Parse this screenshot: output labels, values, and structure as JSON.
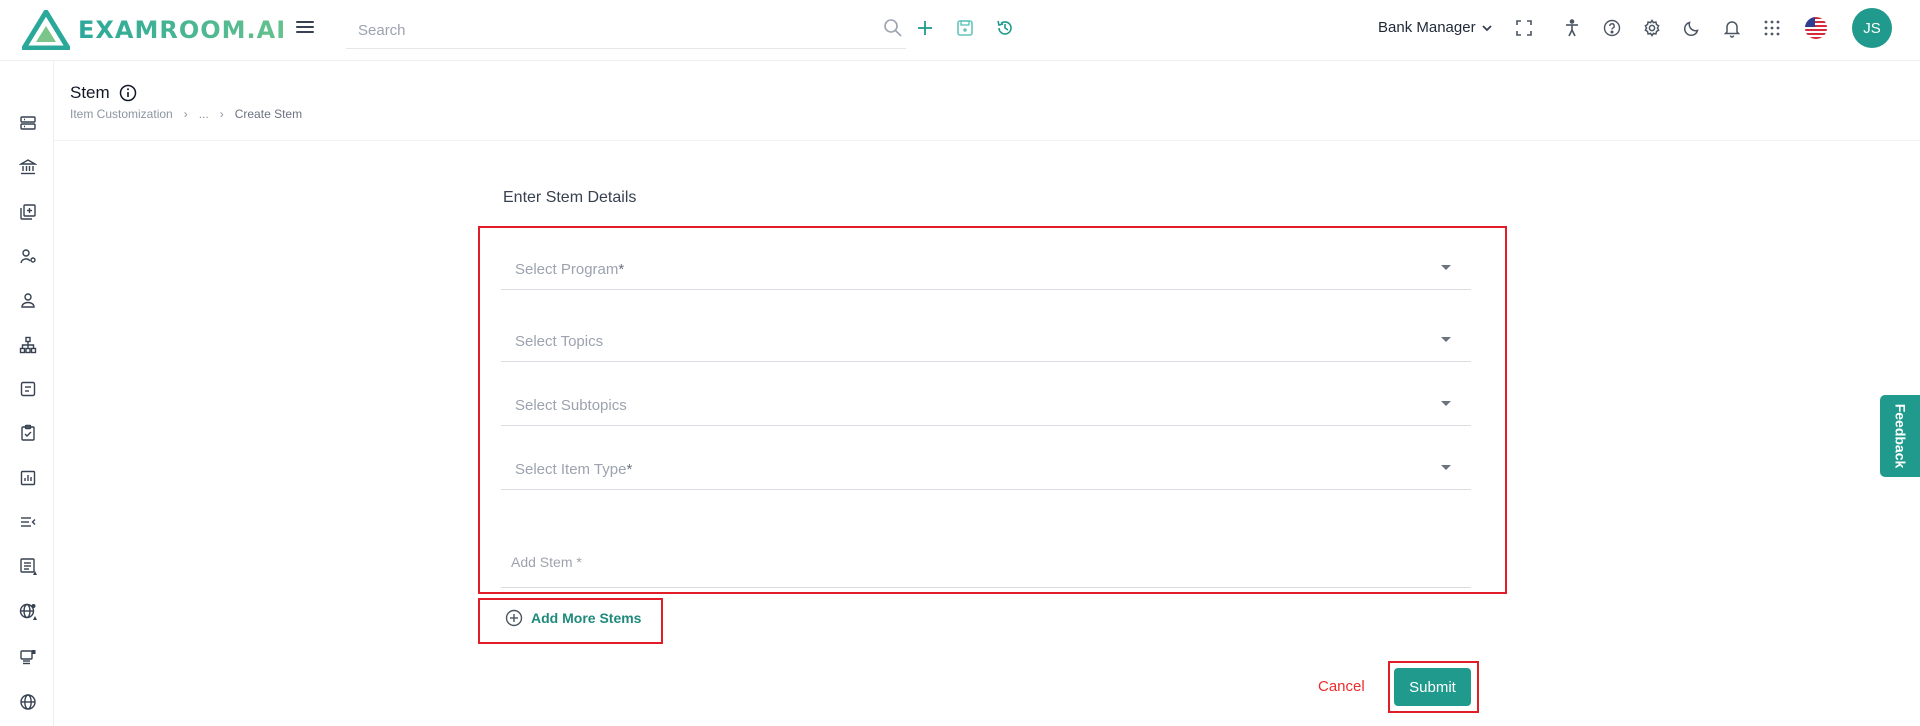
{
  "brand": {
    "name": "EXAMROOM.AI"
  },
  "search": {
    "placeholder": "Search"
  },
  "header": {
    "role": "Bank Manager",
    "avatar_initials": "JS",
    "icons": [
      "add-icon",
      "save-icon",
      "history-icon",
      "fullscreen-icon",
      "accessibility-icon",
      "help-icon",
      "settings-icon",
      "dark-mode-icon",
      "notification-icon",
      "apps-grid-icon",
      "us-flag-icon"
    ]
  },
  "sidebar": {
    "items": [
      "server-icon",
      "bank-icon",
      "add-library-icon",
      "users-settings-icon",
      "user-icon",
      "hierarchy-icon",
      "form-icon",
      "clipboard-check-icon",
      "chart-icon",
      "list-collapse-icon",
      "list-detail-icon",
      "globe-settings-icon",
      "printer-icon",
      "globe-icon"
    ]
  },
  "page": {
    "title": "Stem",
    "breadcrumb": [
      "Item Customization",
      "...",
      "Create Stem"
    ]
  },
  "form": {
    "section_title": "Enter Stem Details",
    "fields": {
      "program": "Select Program",
      "topics": "Select Topics",
      "subtopics": "Select Subtopics",
      "item_type": "Select Item Type",
      "stem": "Add Stem *"
    },
    "required_marker": "*",
    "add_more": "Add More Stems",
    "cancel": "Cancel",
    "submit": "Submit"
  },
  "feedback": {
    "label": "Feedback"
  },
  "colors": {
    "accent": "#1f9a8c",
    "highlight": "#e11d2a",
    "cancel": "#ef2b2b"
  }
}
